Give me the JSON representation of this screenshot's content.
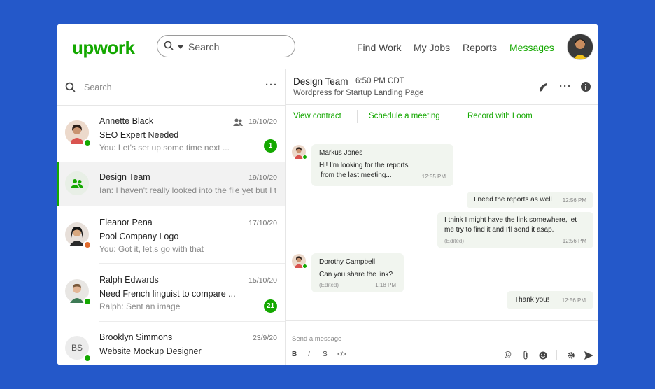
{
  "nav": {
    "logo": "upwork",
    "search_placeholder": "Search",
    "links": [
      "Find Work",
      "My Jobs",
      "Reports",
      "Messages"
    ],
    "active": "Messages"
  },
  "left": {
    "search_placeholder": "Search",
    "conversations": [
      {
        "name": "Annette Black",
        "date": "19/10/20",
        "subject": "SEO Expert Needed",
        "preview": "You: Let's set up some time next ...",
        "badge": "1"
      },
      {
        "name": "Design Team",
        "date": "19/10/20",
        "subject": "",
        "preview": "Ian: I haven't really looked into the file yet but I t",
        "badge": ""
      },
      {
        "name": "Eleanor Pena",
        "date": "17/10/20",
        "subject": "Pool Company Logo",
        "preview": "You: Got it, let,s go with that",
        "badge": ""
      },
      {
        "name": "Ralph Edwards",
        "date": "15/10/20",
        "subject": "Need French linguist to compare ...",
        "preview": "Ralph: Sent an image",
        "badge": "21"
      },
      {
        "name": "Brooklyn Simmons",
        "date": "23/9/20",
        "subject": "Website Mockup Designer",
        "preview": "",
        "badge": "",
        "initials": "BS"
      }
    ]
  },
  "thread": {
    "title": "Design Team",
    "time": "6:50 PM CDT",
    "subtitle": "Wordpress for Startup Landing Page",
    "actions": [
      "View contract",
      "Schedule a meeting",
      "Record with Loom"
    ],
    "messages": [
      {
        "sender": "Markus Jones",
        "lines": [
          "Hi! I'm looking for the reports",
          "from the last meeting..."
        ],
        "time": "12:55 PM",
        "edited": ""
      },
      {
        "sender": "",
        "lines": [
          "I need the reports as well"
        ],
        "time": "12:56 PM",
        "edited": ""
      },
      {
        "sender": "",
        "lines": [
          "I think I might have the link somewhere, let",
          "me try to find it and I'll send it asap."
        ],
        "time": "12:56 PM",
        "edited": "(Edited)"
      },
      {
        "sender": "Dorothy Campbell",
        "lines": [
          "Can you share the link?"
        ],
        "time": "1:18 PM",
        "edited": "(Edited)"
      },
      {
        "sender": "",
        "lines": [
          "Thank you!"
        ],
        "time": "12:56 PM",
        "edited": ""
      }
    ],
    "compose_placeholder": "Send a message",
    "toolbar": {
      "bold": "B",
      "italic": "I",
      "strike": "S",
      "code": "</>"
    }
  },
  "colors": {
    "accent": "#14a800",
    "background": "#2458c9",
    "online": "#14a800",
    "away": "#e06a2b"
  }
}
